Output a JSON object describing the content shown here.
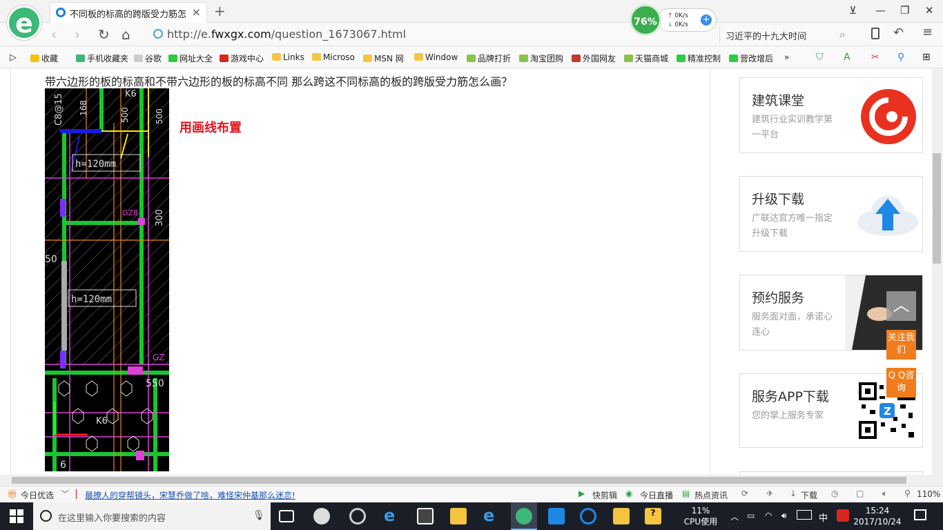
{
  "browser": {
    "tab_title": "不同板的标高的跨版受力筋怎么画",
    "url_prefix": "http://e.",
    "url_domain": "fwxgx.com",
    "url_path": "/question_1673067.html",
    "search_text": "习近平的十九大时间",
    "speed": {
      "percent": "76%",
      "up": "0K/s",
      "down": "0K/s"
    },
    "window_buttons": [
      "⊻",
      "—",
      "❐",
      "✕"
    ]
  },
  "bookmarks": [
    {
      "label": "收藏",
      "color": "#f1c40f"
    },
    {
      "label": "手机收藏夹",
      "color": "#3cb878"
    },
    {
      "label": "谷歌",
      "color": "#cccccc"
    },
    {
      "label": "网址大全",
      "color": "#2ecc40"
    },
    {
      "label": "游戏中心",
      "color": "#d9261c"
    },
    {
      "label": "Links",
      "color": "#f5c542"
    },
    {
      "label": "Microso",
      "color": "#f5c542"
    },
    {
      "label": "MSN 网",
      "color": "#f5c542"
    },
    {
      "label": "Window",
      "color": "#f5c542"
    },
    {
      "label": "品牌打折",
      "color": "#8bc34a"
    },
    {
      "label": "淘宝团购",
      "color": "#8bc34a"
    },
    {
      "label": "外国网友",
      "color": "#c0392b"
    },
    {
      "label": "天猫商城",
      "color": "#8bc34a"
    },
    {
      "label": "精准控制",
      "color": "#2ecc40"
    },
    {
      "label": "营改增后",
      "color": "#2ecc40"
    }
  ],
  "page": {
    "question": "带六边形的板的标高和不带六边形的板的标高不同  那么跨这不同标高的板的跨版受力筋怎么画？",
    "note": "用画线布置",
    "cad_labels": {
      "l1": "h=120mm",
      "l2": "h=120mm",
      "l3": "C8@15",
      "l4": "168",
      "l5": "K6",
      "l6": "500",
      "l7": "500",
      "l8": "300",
      "l9": "550",
      "l10": "50",
      "l11": "6",
      "l12": "K6",
      "l13": "GZ8",
      "l14": "GZ"
    }
  },
  "sidebar": [
    {
      "title": "建筑课堂",
      "desc": "建筑行业实训教学第一平台"
    },
    {
      "title": "升级下载",
      "desc": "广联达官方唯一指定升级下载"
    },
    {
      "title": "预约服务",
      "desc": "服务面对面，承诺心连心"
    },
    {
      "title": "服务APP下载",
      "desc": "您的掌上服务专家"
    }
  ],
  "float_buttons": {
    "to_top": "︿",
    "follow": "关注我们",
    "qq": "Q Q咨询"
  },
  "statusbar": {
    "today": "今日优选",
    "news": "最撩人的穿帮镜头，宋慧乔做了啥，难怪宋仲基那么迷恋!",
    "items": [
      "快剪辑",
      "今日直播",
      "热点资讯",
      "下载"
    ],
    "zoom": "110%"
  },
  "taskbar": {
    "search_placeholder": "在这里输入你要搜索的内容",
    "cpu_percent": "11%",
    "cpu_label": "CPU使用",
    "ime": "中",
    "time": "15:24",
    "date": "2017/10/24"
  }
}
